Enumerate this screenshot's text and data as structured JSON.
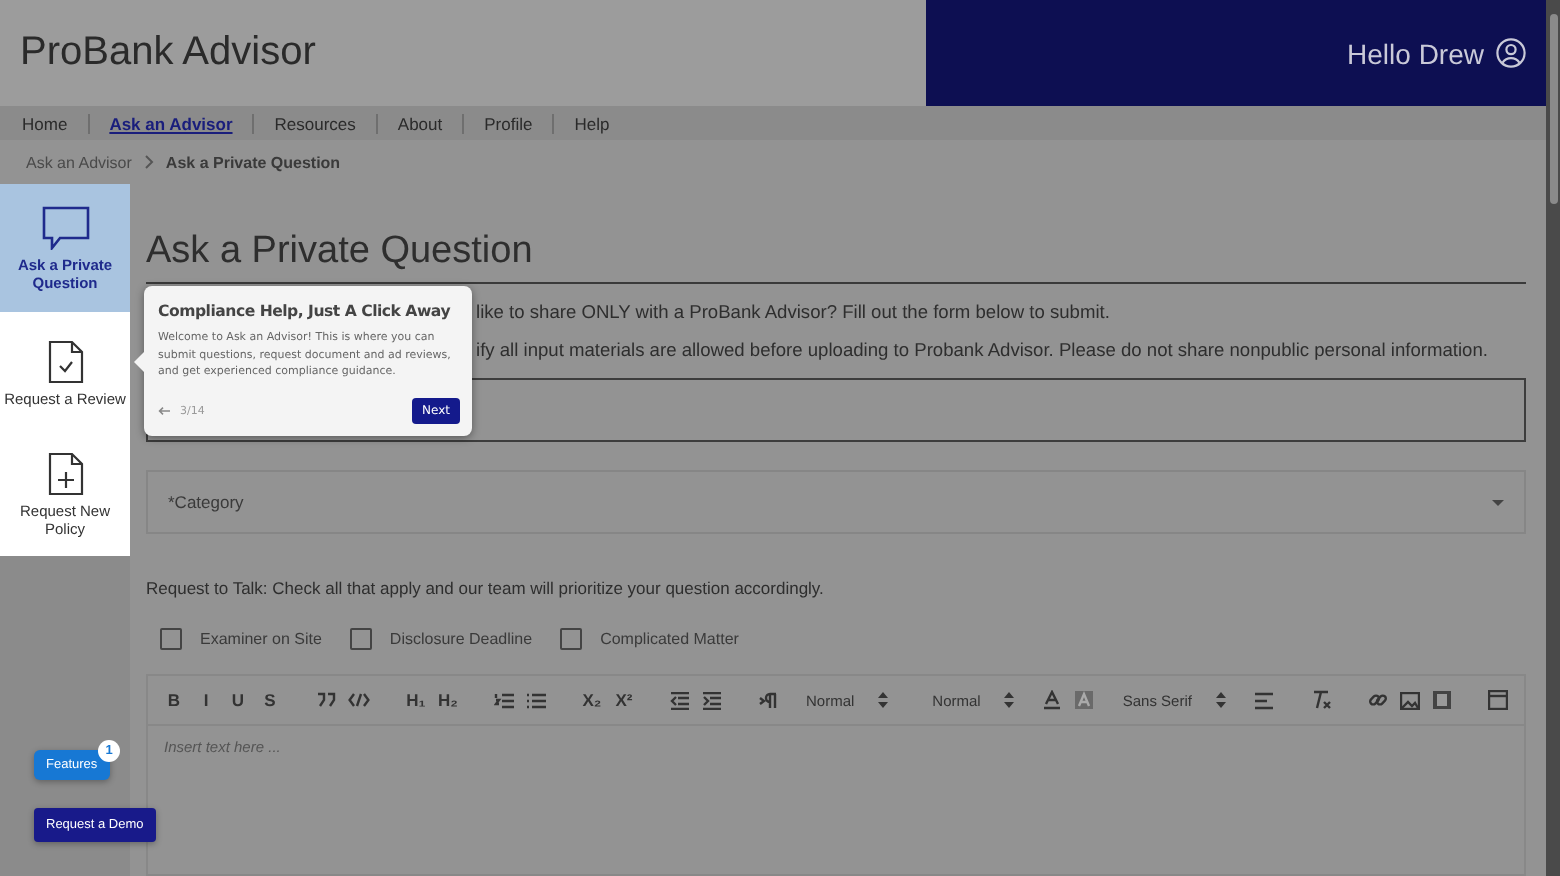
{
  "header": {
    "title": "ProBank Advisor",
    "greeting": "Hello Drew"
  },
  "nav": [
    {
      "label": "Home",
      "selected": false
    },
    {
      "label": "Ask an Advisor",
      "selected": true
    },
    {
      "label": "Resources",
      "selected": false
    },
    {
      "label": "About",
      "selected": false
    },
    {
      "label": "Profile",
      "selected": false
    },
    {
      "label": "Help",
      "selected": false
    }
  ],
  "breadcrumb": [
    "Ask an Advisor",
    "Ask a Private Question"
  ],
  "sidebar": {
    "items": [
      {
        "kind": "chat",
        "label": "Ask a Private Question",
        "selected": true
      },
      {
        "kind": "review",
        "label": "Request a Review",
        "selected": false
      },
      {
        "kind": "new",
        "label": "Request New Policy",
        "selected": false
      }
    ]
  },
  "main": {
    "title": "Ask a Private Question",
    "paragraphs": [
      "like to share ONLY with a ProBank Advisor? Fill out the form below to submit.",
      "ify all input materials are allowed before uploading to Probank Advisor. Please do not share nonpublic personal information."
    ],
    "category": {
      "placeholder": "*Category"
    },
    "request_to_talk": "Request to Talk:  Check all that apply and our team will prioritize your question accordingly.",
    "checkboxes": [
      {
        "label": "Examiner on Site",
        "checked": false
      },
      {
        "label": "Disclosure Deadline",
        "checked": false
      },
      {
        "label": "Complicated Matter",
        "checked": false
      }
    ],
    "toolbar": [
      {
        "kind": "text",
        "label": "B"
      },
      {
        "kind": "text",
        "label": "I"
      },
      {
        "kind": "text",
        "label": "U"
      },
      {
        "kind": "text",
        "label": "S"
      },
      {
        "kind": "gap"
      },
      {
        "kind": "quote"
      },
      {
        "kind": "code"
      },
      {
        "kind": "gap"
      },
      {
        "kind": "text",
        "label": "H₁"
      },
      {
        "kind": "text",
        "label": "H₂"
      },
      {
        "kind": "gap"
      },
      {
        "kind": "ordered"
      },
      {
        "kind": "bullets"
      },
      {
        "kind": "gap"
      },
      {
        "kind": "text",
        "label": "X₂"
      },
      {
        "kind": "text",
        "label": "X²"
      },
      {
        "kind": "gap"
      },
      {
        "kind": "outdent"
      },
      {
        "kind": "indent"
      },
      {
        "kind": "gap"
      },
      {
        "kind": "direction"
      },
      {
        "kind": "select",
        "label": "Normal"
      },
      {
        "kind": "select",
        "label": "Normal"
      },
      {
        "kind": "color"
      },
      {
        "kind": "background"
      },
      {
        "kind": "select",
        "label": "Sans Serif"
      },
      {
        "kind": "align"
      },
      {
        "kind": "gap"
      },
      {
        "kind": "clean"
      },
      {
        "kind": "gap"
      },
      {
        "kind": "link"
      },
      {
        "kind": "image"
      },
      {
        "kind": "video"
      },
      {
        "kind": "gap"
      },
      {
        "kind": "table"
      }
    ],
    "editor": {
      "placeholder": "Insert text here ..."
    }
  },
  "popover": {
    "title": "Compliance Help, Just A Click Away",
    "body": "Welcome to Ask an Advisor! This is where you can submit questions, request document and ad reviews, and get experienced compliance guidance.",
    "step": "3/14",
    "next": "Next"
  },
  "widgets": {
    "features": {
      "label": "Features",
      "badge": "1"
    },
    "demo": "Request a Demo"
  }
}
